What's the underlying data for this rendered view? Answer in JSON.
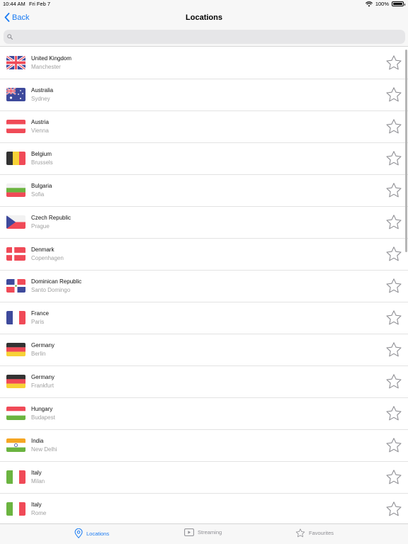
{
  "status_bar": {
    "time": "10:44 AM",
    "day": "Fri Feb 7",
    "battery": "100%"
  },
  "nav": {
    "back_label": "Back",
    "title": "Locations"
  },
  "search": {
    "placeholder": ""
  },
  "locations": [
    {
      "country": "United Kingdom",
      "city": "Manchester",
      "flag": "gb"
    },
    {
      "country": "Australia",
      "city": "Sydney",
      "flag": "au"
    },
    {
      "country": "Austria",
      "city": "Vienna",
      "flag": "at"
    },
    {
      "country": "Belgium",
      "city": "Brussels",
      "flag": "be"
    },
    {
      "country": "Bulgaria",
      "city": "Sofia",
      "flag": "bg"
    },
    {
      "country": "Czech Republic",
      "city": "Prague",
      "flag": "cz"
    },
    {
      "country": "Denmark",
      "city": "Copenhagen",
      "flag": "dk"
    },
    {
      "country": "Dominican Republic",
      "city": "Santo Domingo",
      "flag": "do"
    },
    {
      "country": "France",
      "city": "Paris",
      "flag": "fr"
    },
    {
      "country": "Germany",
      "city": "Berlin",
      "flag": "de"
    },
    {
      "country": "Germany",
      "city": "Frankfurt",
      "flag": "de"
    },
    {
      "country": "Hungary",
      "city": "Budapest",
      "flag": "hu"
    },
    {
      "country": "India",
      "city": "New Delhi",
      "flag": "in"
    },
    {
      "country": "Italy",
      "city": "Milan",
      "flag": "it"
    },
    {
      "country": "Italy",
      "city": "Rome",
      "flag": "it"
    }
  ],
  "tabs": [
    {
      "label": "Locations",
      "icon": "location-pin-icon",
      "active": true
    },
    {
      "label": "Streaming",
      "icon": "play-screen-icon",
      "active": false
    },
    {
      "label": "Favourites",
      "icon": "star-icon",
      "active": false
    }
  ],
  "colors": {
    "accent": "#1a7bf2",
    "inactive": "#8e8e93",
    "flag_red": "#f04a57",
    "flag_blue": "#3e4a9c"
  }
}
